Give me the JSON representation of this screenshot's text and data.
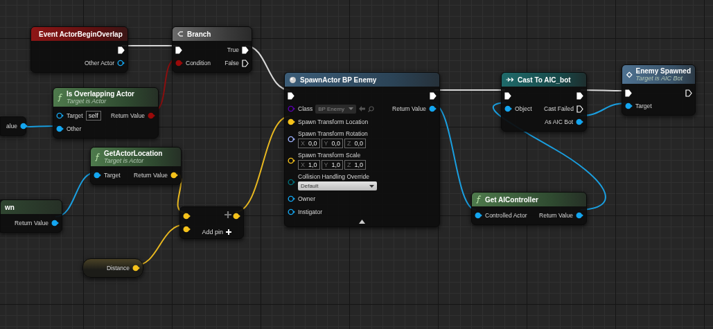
{
  "graph": {
    "nodes": [
      {
        "kind": "partial",
        "outputs": [
          {
            "label": "alue",
            "kind": "object",
            "connected": true
          }
        ]
      },
      {
        "kind": "event",
        "title": "Event ActorBeginOverlap",
        "outputs": [
          {
            "kind": "exec",
            "connected": true
          },
          {
            "label": "Other Actor",
            "kind": "object",
            "connected": false
          }
        ]
      },
      {
        "kind": "flow",
        "title": "Branch",
        "inputs": [
          {
            "kind": "exec",
            "connected": true
          },
          {
            "label": "Condition",
            "kind": "bool",
            "connected": true
          }
        ],
        "outputs": [
          {
            "label": "True",
            "kind": "exec",
            "connected": true
          },
          {
            "label": "False",
            "kind": "exec",
            "connected": false
          }
        ]
      },
      {
        "kind": "function",
        "title": "Is Overlapping Actor",
        "subtitle": "Target is Actor",
        "inputs": [
          {
            "label": "Target",
            "kind": "object",
            "connected": false,
            "default": "self"
          },
          {
            "label": "Other",
            "kind": "object",
            "connected": true
          }
        ],
        "outputs": [
          {
            "label": "Return Value",
            "kind": "bool",
            "connected": true
          }
        ]
      },
      {
        "kind": "function",
        "title": "GetActorLocation",
        "subtitle": "Target is Actor",
        "inputs": [
          {
            "label": "Target",
            "kind": "object",
            "connected": true
          }
        ],
        "outputs": [
          {
            "label": "Return Value",
            "kind": "vector",
            "connected": true
          }
        ]
      },
      {
        "kind": "partial",
        "title": "wn",
        "outputs": [
          {
            "label": "Return Value",
            "kind": "object",
            "connected": true
          }
        ]
      },
      {
        "kind": "math",
        "add_pin": "Add pin",
        "inputs": [
          {
            "kind": "vector",
            "connected": true
          },
          {
            "kind": "vector",
            "connected": true
          }
        ],
        "outputs": [
          {
            "kind": "vector",
            "connected": true
          }
        ]
      },
      {
        "kind": "variable",
        "outputs": [
          {
            "label": "Distance",
            "kind": "vector",
            "connected": true
          }
        ]
      },
      {
        "kind": "spawn",
        "title": "SpawnActor BP Enemy",
        "inputs": [
          {
            "kind": "exec",
            "connected": true
          },
          {
            "label": "Class",
            "kind": "class",
            "connected": false,
            "dropdown": "BP Enemy"
          },
          {
            "label": "Spawn Transform Location",
            "kind": "vector",
            "connected": true
          },
          {
            "label": "Spawn Transform Rotation",
            "kind": "rotator",
            "connected": false,
            "fields": [
              {
                "axis": "X",
                "value": "0,0"
              },
              {
                "axis": "Y",
                "value": "0,0"
              },
              {
                "axis": "Z",
                "value": "0,0"
              }
            ]
          },
          {
            "label": "Spawn Transform Scale",
            "kind": "vector",
            "connected": false,
            "fields": [
              {
                "axis": "X",
                "value": "1,0"
              },
              {
                "axis": "Y",
                "value": "1,0"
              },
              {
                "axis": "Z",
                "value": "1,0"
              }
            ]
          },
          {
            "label": "Collision Handling Override",
            "kind": "enum",
            "connected": false,
            "dropdown": "Default"
          },
          {
            "label": "Owner",
            "kind": "object",
            "connected": false
          },
          {
            "label": "Instigator",
            "kind": "object",
            "connected": false
          }
        ],
        "outputs": [
          {
            "kind": "exec",
            "connected": true
          },
          {
            "label": "Return Value",
            "kind": "object",
            "connected": true
          }
        ],
        "advanced": true
      },
      {
        "kind": "cast",
        "title": "Cast To AIC_bot",
        "inputs": [
          {
            "kind": "exec",
            "connected": true
          },
          {
            "label": "Object",
            "kind": "object",
            "connected": true
          }
        ],
        "outputs": [
          {
            "kind": "exec",
            "connected": true
          },
          {
            "label": "Cast Failed",
            "kind": "exec",
            "connected": false
          },
          {
            "label": "As AIC Bot",
            "kind": "object",
            "connected": true
          }
        ]
      },
      {
        "kind": "custom_event",
        "title": "Enemy Spawned",
        "subtitle": "Target is AIC Bot",
        "inputs": [
          {
            "kind": "exec",
            "connected": true
          },
          {
            "label": "Target",
            "kind": "object",
            "connected": true
          }
        ],
        "outputs": [
          {
            "kind": "exec",
            "connected": false
          }
        ]
      },
      {
        "kind": "function",
        "title": "Get AIController",
        "inputs": [
          {
            "label": "Controlled Actor",
            "kind": "object",
            "connected": true
          }
        ],
        "outputs": [
          {
            "label": "Return Value",
            "kind": "object",
            "connected": true
          }
        ]
      }
    ]
  }
}
